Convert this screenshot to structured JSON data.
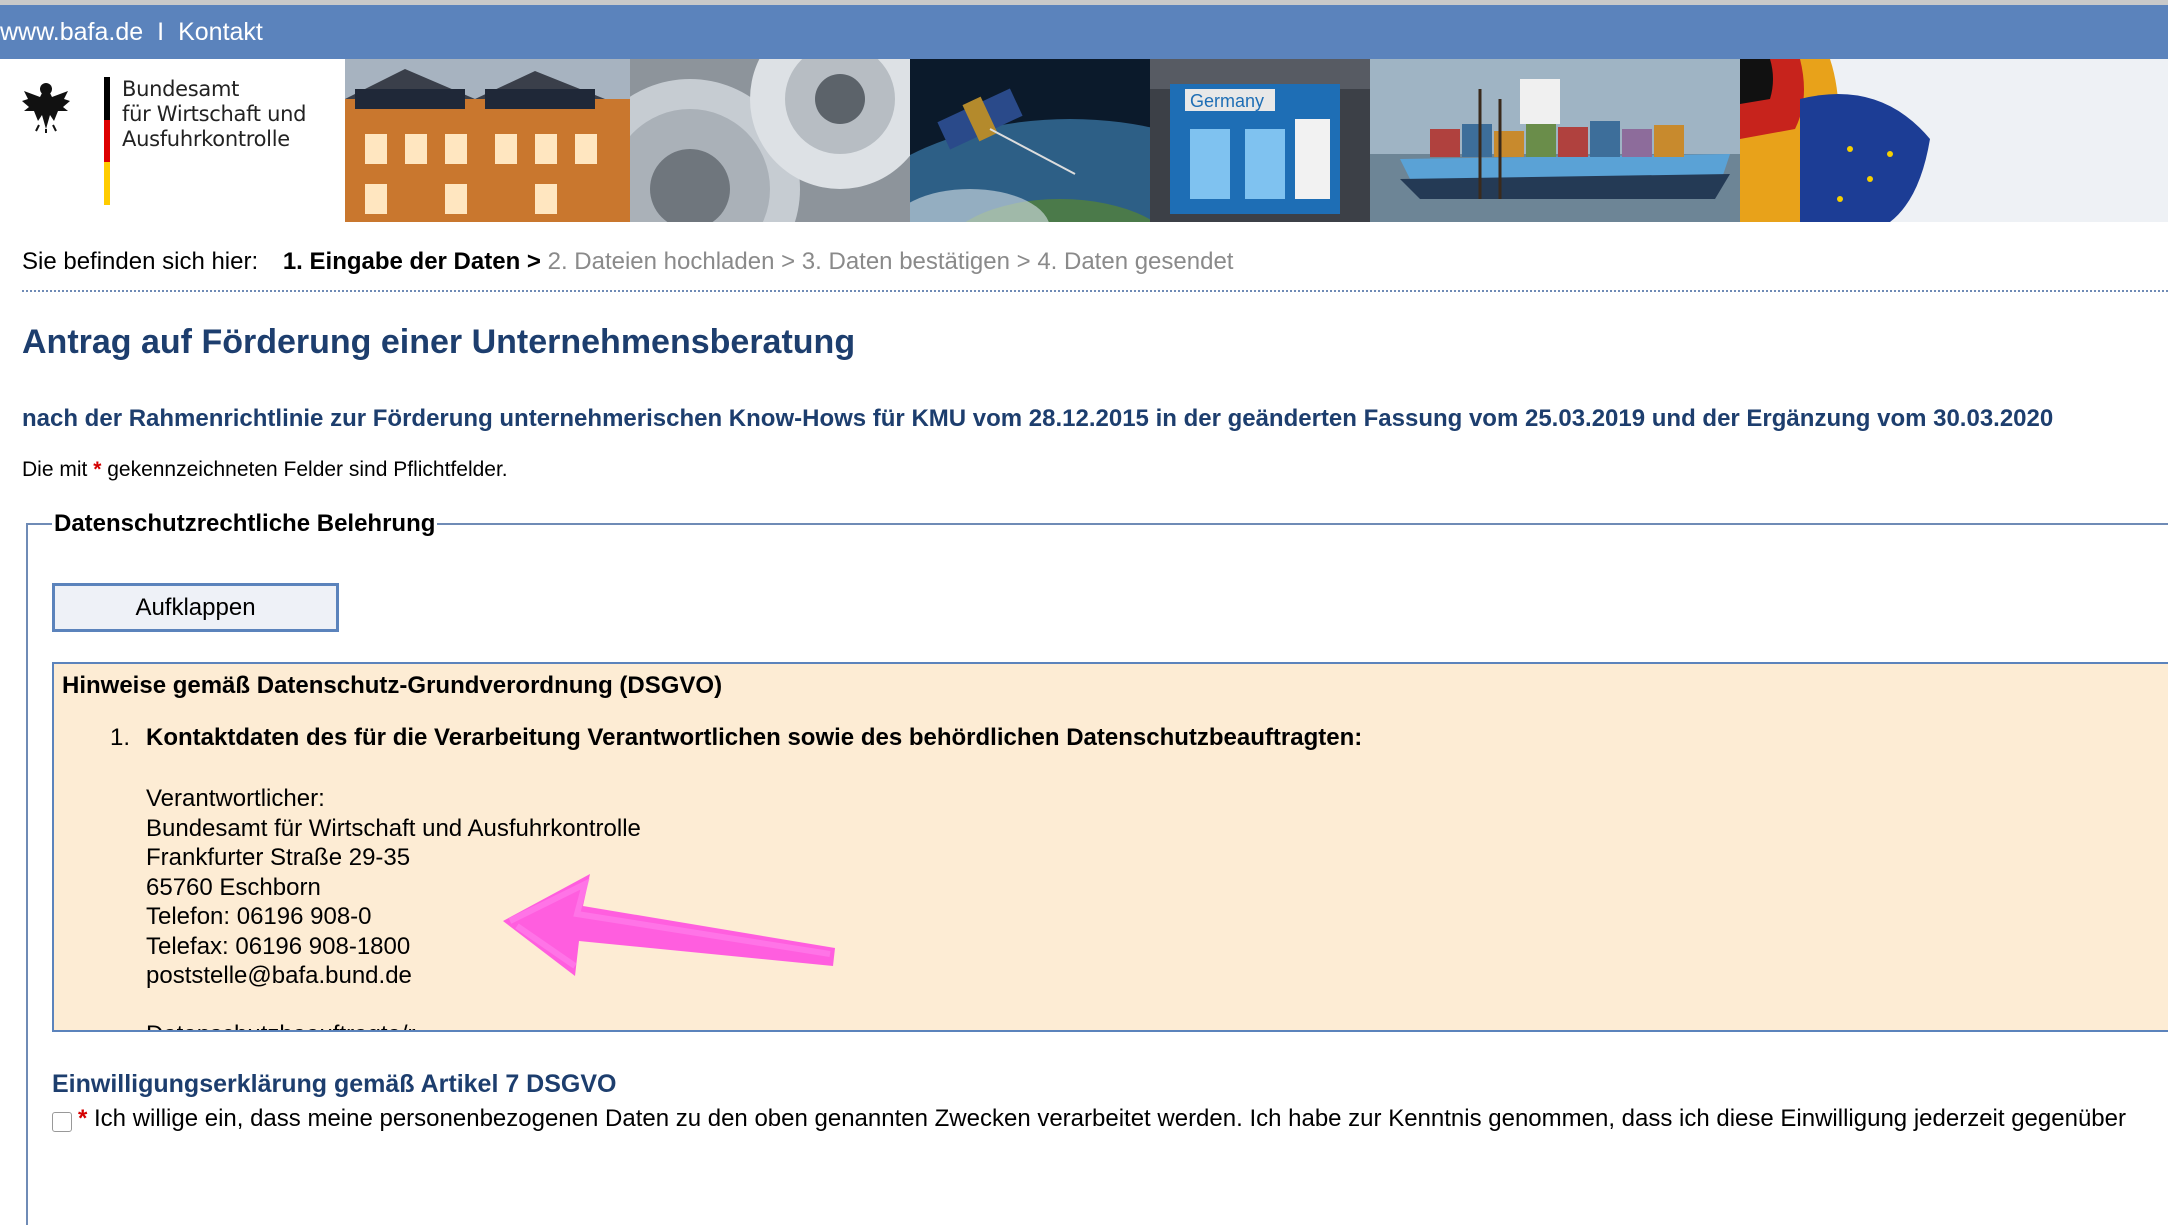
{
  "topbar": {
    "site_link": "www.bafa.de",
    "separator": "I",
    "contact_link": "Kontakt"
  },
  "logo": {
    "line1": "Bundesamt",
    "line2": "für Wirtschaft und",
    "line3": "Ausfuhrkontrolle"
  },
  "breadcrumb": {
    "prefix": "Sie befinden sich hier:",
    "step1": "1. Eingabe der Daten >",
    "step2": "2. Dateien hochladen >",
    "step3": "3. Daten bestätigen >",
    "step4": "4. Daten gesendet"
  },
  "page": {
    "title": "Antrag auf Förderung einer Unternehmensberatung",
    "subtitle": "nach der Rahmenrichtlinie zur Förderung unternehmerischen Know-Hows für KMU vom 28.12.2015 in der geänderten Fassung vom 25.03.2019 und der Ergänzung vom 30.03.2020",
    "required_before": "Die mit",
    "required_star": "*",
    "required_after": "gekennzeichneten Felder sind Pflichtfelder."
  },
  "privacy": {
    "legend": "Datenschutzrechtliche Belehrung",
    "expand_button": "Aufklappen",
    "box_title": "Hinweise gemäß Datenschutz-Grundverordnung (DSGVO)",
    "item_number": "1.",
    "item_heading": "Kontaktdaten des für die Verarbeitung Verantwortlichen sowie des behördlichen Datenschutzbeauftragten:",
    "address_lines": [
      "Verantwortlicher:",
      "Bundesamt für Wirtschaft und Ausfuhrkontrolle",
      "Frankfurter Straße 29-35",
      "65760 Eschborn",
      "Telefon: 06196 908-0",
      "Telefax: 06196 908-1800",
      "poststelle@bafa.bund.de"
    ],
    "cutoff_text": "Datenschutzbeauftragte/r"
  },
  "consent": {
    "title": "Einwilligungserklärung gemäß Artikel 7 DSGVO",
    "star": "*",
    "text": "Ich willige ein, dass meine personenbezogenen Daten zu den oben genannten Zwecken verarbeitet werden. Ich habe zur Kenntnis genommen, dass ich diese Einwilligung jederzeit gegenüber"
  },
  "colors": {
    "topbar": "#5b83bc",
    "heading": "#1d3e6e",
    "box_bg": "#fdecd4",
    "arrow": "#ff4fe0"
  },
  "icons": {
    "logo": "federal-eagle-icon",
    "annotation": "pink-arrow-icon"
  }
}
